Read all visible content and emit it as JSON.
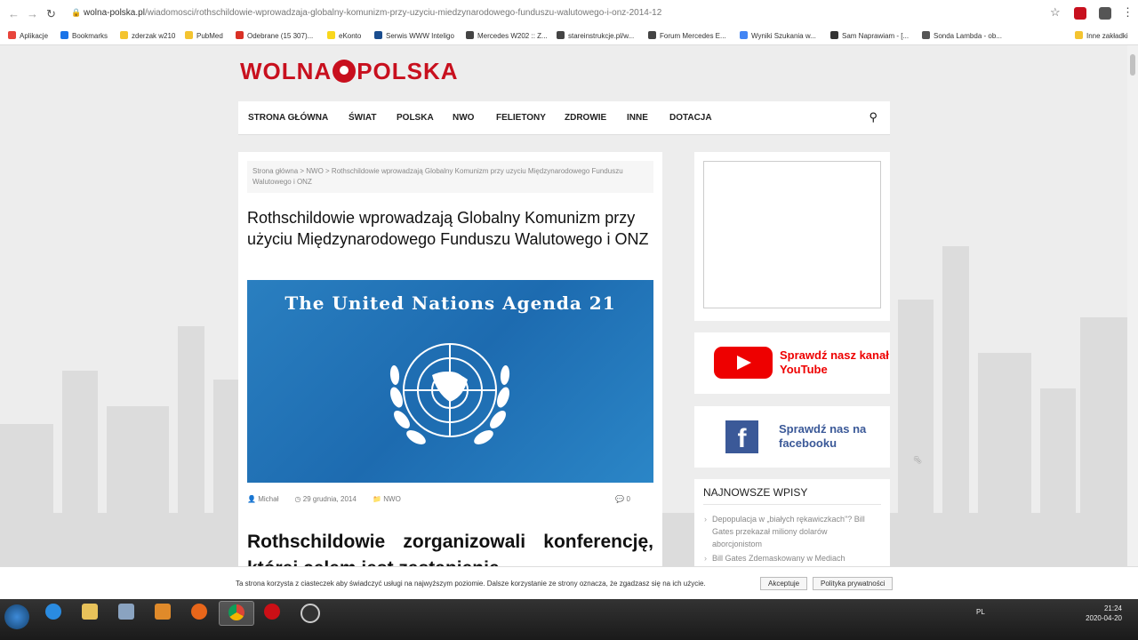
{
  "browser": {
    "url_domain": "wolna-polska.pl",
    "url_path": "/wiadomosci/rothschildowie-wprowadzaja-globalny-komunizm-przy-uzyciu-miedzynarodowego-funduszu-walutowego-i-onz-2014-12"
  },
  "bookmarks": [
    {
      "label": "Aplikacje",
      "color": "#e8453c"
    },
    {
      "label": "Bookmarks",
      "color": "#1a73e8"
    },
    {
      "label": "zderzak w210",
      "color": "#f4c430"
    },
    {
      "label": "PubMed",
      "color": "#f4c430"
    },
    {
      "label": "Odebrane (15 307)...",
      "color": "#d93025"
    },
    {
      "label": "eKonto",
      "color": "#f9d71c"
    },
    {
      "label": "Serwis WWW Inteligo",
      "color": "#1a4d8f"
    },
    {
      "label": "Mercedes W202 :: Z...",
      "color": "#444444"
    },
    {
      "label": "stareinstrukcje.pl/w...",
      "color": "#444444"
    },
    {
      "label": "Forum Mercedes E...",
      "color": "#444444"
    },
    {
      "label": "Wyniki Szukania w...",
      "color": "#4285f4"
    },
    {
      "label": "Sam Naprawiam - [...",
      "color": "#333333"
    },
    {
      "label": "Sonda Lambda - ob...",
      "color": "#555555"
    },
    {
      "label": "Inne zakładki",
      "color": "#f4c430"
    }
  ],
  "site": {
    "logo_left": "WOLNA",
    "logo_right": "POLSKA"
  },
  "nav": [
    "STRONA GŁÓWNA",
    "ŚWIAT",
    "POLSKA",
    "NWO",
    "FELIETONY",
    "ZDROWIE",
    "INNE",
    "DOTACJA"
  ],
  "article": {
    "breadcrumb": "Strona główna > NWO > Rothschildowie wprowadzają Globalny Komunizm przy uzyciu Międzynarodowego Funduszu Walutowego i ONZ",
    "title": "Rothschildowie wprowadzają Globalny Komunizm przy użyciu Międzynarodowego Funduszu Walutowego i ONZ",
    "image_caption": "The United Nations Agenda 21",
    "author": "Michał",
    "date": "29 grudnia, 2014",
    "category": "NWO",
    "comments": "0",
    "lead": "Rothschildowie zorganizowali konferencję, której celem jest zastąpienie"
  },
  "sidebar": {
    "youtube_text": "Sprawdź nasz kanał YouTube",
    "facebook_text": "Sprawdź nas na facebooku",
    "latest_heading": "NAJNOWSZE WPISY",
    "latest_posts": [
      "Depopulacja w „białych rękawiczkach\"? Bill Gates przekazał miliony dolarów aborcjonistom",
      "Bill Gates Zdemaskowany w Mediach"
    ]
  },
  "cookie": {
    "message": "Ta strona korzysta z ciasteczek aby świadczyć usługi na najwyższym poziomie. Dalsze korzystanie ze strony oznacza, że zgadzasz się na ich użycie.",
    "accept": "Akceptuje",
    "policy": "Polityka prywatności"
  },
  "taskbar": {
    "lang": "PL",
    "time": "21:24",
    "date": "2020-04-20"
  }
}
